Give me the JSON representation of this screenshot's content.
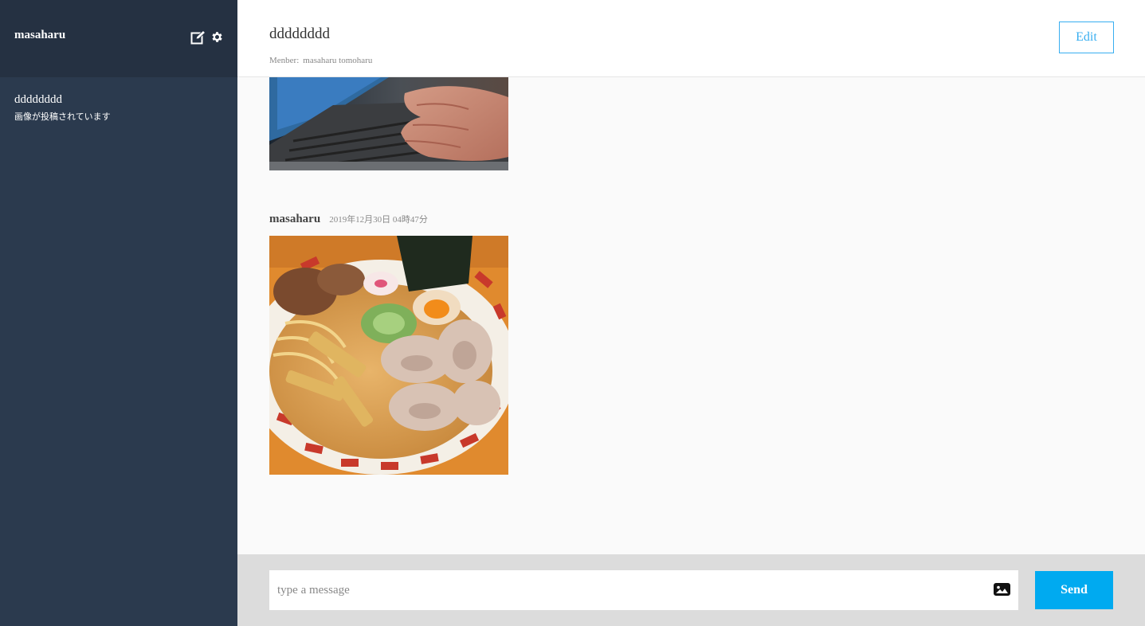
{
  "sidebar": {
    "user_name": "masaharu",
    "icons": [
      "edit-icon",
      "gear-icon"
    ],
    "groups": [
      {
        "name": "dddddddd",
        "last_message": "画像が投稿されています"
      }
    ]
  },
  "header": {
    "chat_title": "dddddddd",
    "member_label": "Menber:",
    "members": "masaharu tomoharu",
    "edit_label": "Edit"
  },
  "messages": [
    {
      "user": "",
      "date": "",
      "image": "laptop-typing-photo"
    },
    {
      "user": "masaharu",
      "date": "2019年12月30日 04時47分",
      "image": "ramen-bowl-photo"
    }
  ],
  "form": {
    "placeholder": "type a message",
    "send_label": "Send",
    "image_icon": "image-icon"
  },
  "colors": {
    "sidebar_bg": "#2b3a4e",
    "sidebar_header_bg": "#253142",
    "accent": "#00aaf0",
    "edit_border": "#38aef0",
    "form_bg": "#dcdcdc"
  }
}
